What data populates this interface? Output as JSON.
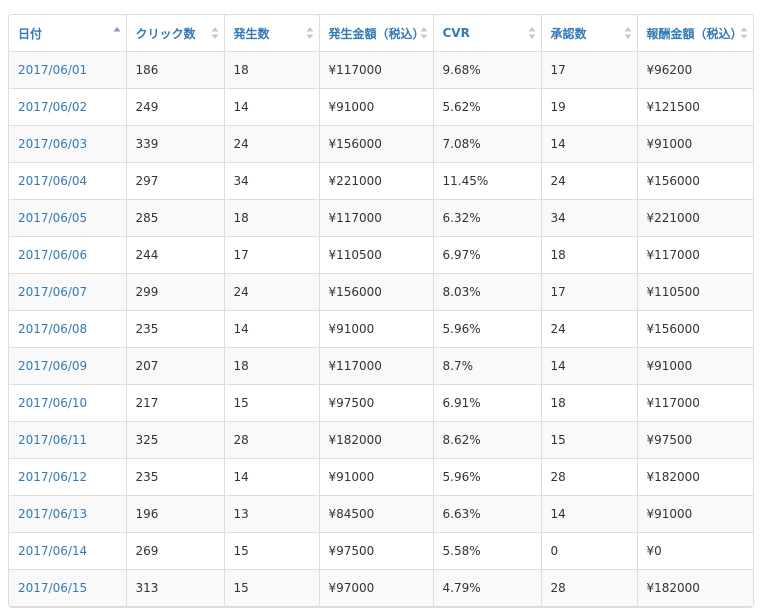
{
  "table": {
    "columns": [
      {
        "label": "日付",
        "sort": "asc"
      },
      {
        "label": "クリック数",
        "sort": "none"
      },
      {
        "label": "発生数",
        "sort": "none"
      },
      {
        "label": "発生金額（税込）",
        "sort": "none"
      },
      {
        "label": "CVR",
        "sort": "none"
      },
      {
        "label": "承認数",
        "sort": "none"
      },
      {
        "label": "報酬金額（税込）",
        "sort": "none"
      }
    ],
    "rows": [
      [
        "2017/06/01",
        "186",
        "18",
        "¥117000",
        "9.68%",
        "17",
        "¥96200"
      ],
      [
        "2017/06/02",
        "249",
        "14",
        "¥91000",
        "5.62%",
        "19",
        "¥121500"
      ],
      [
        "2017/06/03",
        "339",
        "24",
        "¥156000",
        "7.08%",
        "14",
        "¥91000"
      ],
      [
        "2017/06/04",
        "297",
        "34",
        "¥221000",
        "11.45%",
        "24",
        "¥156000"
      ],
      [
        "2017/06/05",
        "285",
        "18",
        "¥117000",
        "6.32%",
        "34",
        "¥221000"
      ],
      [
        "2017/06/06",
        "244",
        "17",
        "¥110500",
        "6.97%",
        "18",
        "¥117000"
      ],
      [
        "2017/06/07",
        "299",
        "24",
        "¥156000",
        "8.03%",
        "17",
        "¥110500"
      ],
      [
        "2017/06/08",
        "235",
        "14",
        "¥91000",
        "5.96%",
        "24",
        "¥156000"
      ],
      [
        "2017/06/09",
        "207",
        "18",
        "¥117000",
        "8.7%",
        "14",
        "¥91000"
      ],
      [
        "2017/06/10",
        "217",
        "15",
        "¥97500",
        "6.91%",
        "18",
        "¥117000"
      ],
      [
        "2017/06/11",
        "325",
        "28",
        "¥182000",
        "8.62%",
        "15",
        "¥97500"
      ],
      [
        "2017/06/12",
        "235",
        "14",
        "¥91000",
        "5.96%",
        "28",
        "¥182000"
      ],
      [
        "2017/06/13",
        "196",
        "13",
        "¥84500",
        "6.63%",
        "14",
        "¥91000"
      ],
      [
        "2017/06/14",
        "269",
        "15",
        "¥97500",
        "5.58%",
        "0",
        "¥0"
      ],
      [
        "2017/06/15",
        "313",
        "15",
        "¥97000",
        "4.79%",
        "28",
        "¥182000"
      ]
    ]
  },
  "colors": {
    "link": "#337ab7",
    "sort_active": "#8a8fd6",
    "sort_inactive": "#c8c8c8",
    "border": "#dddddd",
    "stripe": "#f9f9f9"
  },
  "icons": {
    "sort_asc": "sort-ascending-icon",
    "sort_none": "sort-both-icon"
  }
}
